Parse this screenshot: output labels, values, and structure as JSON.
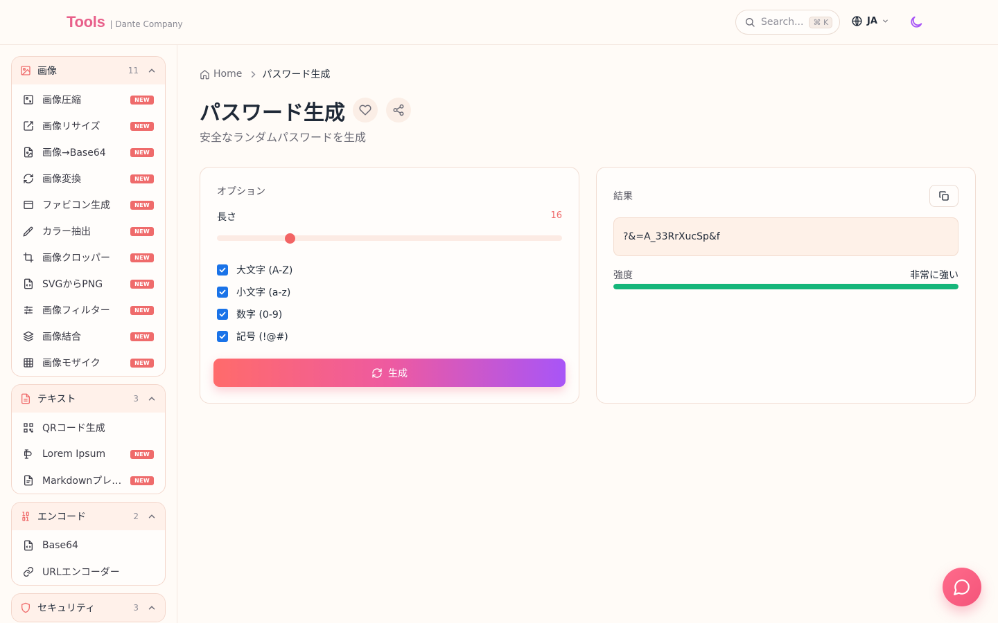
{
  "header": {
    "brand": "Tools",
    "brand_sub": "| Dante Company",
    "search_placeholder": "Search...",
    "search_shortcut": "⌘ K",
    "language": "JA"
  },
  "sidebar": {
    "groups": [
      {
        "title": "画像",
        "count": "11",
        "icon": "image-icon",
        "items": [
          {
            "label": "画像圧縮",
            "badge": "NEW",
            "icon": "image-compress-icon"
          },
          {
            "label": "画像リサイズ",
            "badge": "NEW",
            "icon": "resize-icon"
          },
          {
            "label": "画像→Base64",
            "badge": "NEW",
            "icon": "file-image-icon"
          },
          {
            "label": "画像変換",
            "badge": "NEW",
            "icon": "refresh-icon"
          },
          {
            "label": "ファビコン生成",
            "badge": "NEW",
            "icon": "browser-window-icon"
          },
          {
            "label": "カラー抽出",
            "badge": "NEW",
            "icon": "pipette-icon"
          },
          {
            "label": "画像クロッパー",
            "badge": "NEW",
            "icon": "crop-icon"
          },
          {
            "label": "SVGからPNG",
            "badge": "NEW",
            "icon": "file-code-icon"
          },
          {
            "label": "画像フィルター",
            "badge": "NEW",
            "icon": "sliders-icon"
          },
          {
            "label": "画像結合",
            "badge": "NEW",
            "icon": "layers-icon"
          },
          {
            "label": "画像モザイク",
            "badge": "NEW",
            "icon": "grid-icon"
          }
        ]
      },
      {
        "title": "テキスト",
        "count": "3",
        "icon": "file-text-icon",
        "items": [
          {
            "label": "QRコード生成",
            "badge": "",
            "icon": "qr-code-icon"
          },
          {
            "label": "Lorem Ipsum",
            "badge": "NEW",
            "icon": "text-cursor-icon"
          },
          {
            "label": "Markdownプレビュー",
            "badge": "NEW",
            "icon": "file-markdown-icon"
          }
        ]
      },
      {
        "title": "エンコード",
        "count": "2",
        "icon": "binary-icon",
        "items": [
          {
            "label": "Base64",
            "badge": "",
            "icon": "file-code-icon"
          },
          {
            "label": "URLエンコーダー",
            "badge": "",
            "icon": "link-icon"
          }
        ]
      },
      {
        "title": "セキュリティ",
        "count": "3",
        "icon": "shield-icon",
        "items": []
      }
    ]
  },
  "breadcrumb": {
    "home": "Home",
    "current": "パスワード生成"
  },
  "page": {
    "title": "パスワード生成",
    "subtitle": "安全なランダムパスワードを生成"
  },
  "options": {
    "heading": "オプション",
    "length_label": "長さ",
    "length_value": 16,
    "length_fraction": 0.21,
    "checkboxes": [
      {
        "label": "大文字 (A-Z)",
        "checked": true
      },
      {
        "label": "小文字 (a-z)",
        "checked": true
      },
      {
        "label": "数字 (0-9)",
        "checked": true
      },
      {
        "label": "記号 (!@#)",
        "checked": true
      }
    ],
    "generate_label": "生成"
  },
  "result": {
    "heading": "結果",
    "password": "?&=A_33RrXucSp&f",
    "strength_label": "強度",
    "strength_value": "非常に強い",
    "strength_fraction": 1.0
  },
  "colors": {
    "accent": "#ef6b6b",
    "brand": "#e85f8a",
    "strength": "#16b67a",
    "checkbox": "#1a73e8",
    "theme_toggle": "#a855f7"
  }
}
